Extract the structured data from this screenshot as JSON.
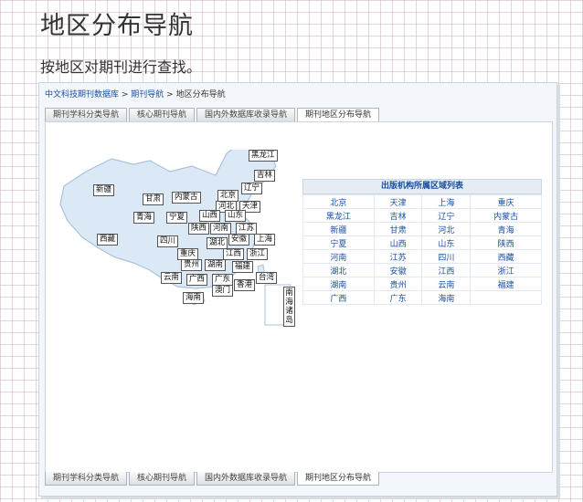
{
  "page": {
    "title": "地区分布导航",
    "subtitle": "按地区对期刊进行查找。"
  },
  "breadcrumb": {
    "home": "中文科技期刊数据库",
    "sep1": " > ",
    "nav": "期刊导航",
    "sep2": " > ",
    "current": "地区分布导航"
  },
  "tabs": [
    {
      "label": "期刊学科分类导航",
      "active": false
    },
    {
      "label": "核心期刊导航",
      "active": false
    },
    {
      "label": "国内外数据库收录导航",
      "active": false
    },
    {
      "label": "期刊地区分布导航",
      "active": true
    }
  ],
  "map": {
    "provinces": {
      "heilongjiang": "黑龙江",
      "jilin": "吉林",
      "xinjiang": "新疆",
      "gansu": "甘肃",
      "neimenggu": "内蒙古",
      "beijing": "北京",
      "liaoning": "辽宁",
      "hebei": "河北",
      "tianjin": "天津",
      "qinghai": "青海",
      "ningxia": "宁夏",
      "shanxi": "山西",
      "shandong": "山东",
      "shaanxi": "陕西",
      "henan": "河南",
      "jiangsu": "江苏",
      "xizang": "西藏",
      "sichuan": "四川",
      "hubei": "湖北",
      "anhui": "安徽",
      "shanghai": "上海",
      "chongqing": "重庆",
      "jiangxi": "江西",
      "zhejiang": "浙江",
      "guizhou": "贵州",
      "hunan": "湖南",
      "fujian": "福建",
      "yunnan": "云南",
      "guangxi": "广西",
      "guangdong": "广东",
      "taiwan": "台湾",
      "xianggang": "香港",
      "aomen": "澳门",
      "hainan": "海南",
      "nanhai": "南海诸岛"
    }
  },
  "publisher_regions": {
    "title": "出版机构所属区域列表",
    "rows": [
      [
        "北京",
        "天津",
        "上海",
        "重庆"
      ],
      [
        "黑龙江",
        "吉林",
        "辽宁",
        "内蒙古"
      ],
      [
        "新疆",
        "甘肃",
        "河北",
        "青海"
      ],
      [
        "宁夏",
        "山西",
        "山东",
        "陕西"
      ],
      [
        "河南",
        "江苏",
        "四川",
        "西藏"
      ],
      [
        "湖北",
        "安徽",
        "江西",
        "浙江"
      ],
      [
        "湖南",
        "贵州",
        "云南",
        "福建"
      ],
      [
        "广西",
        "广东",
        "海南",
        ""
      ]
    ]
  },
  "colors": {
    "link": "#1a4fa0",
    "map_land": "#dbe9f6",
    "map_border": "#a9c3dc",
    "grid_line": "#ceb0c4"
  }
}
